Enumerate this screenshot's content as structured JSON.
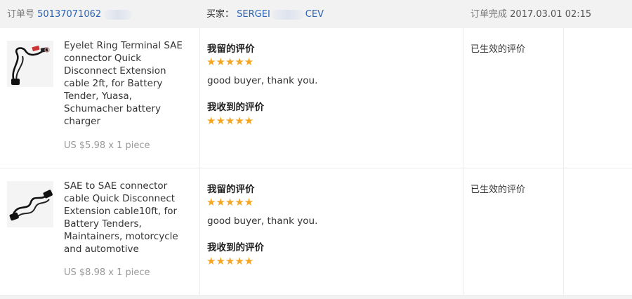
{
  "header": {
    "order_label": "订单号",
    "order_number": "50137071062",
    "buyer_label": "买家：",
    "buyer_name_start": "SERGEI",
    "buyer_name_end": "CEV",
    "status_label": "订单完成",
    "completed_time": "2017.03.01 02:15"
  },
  "orders": [
    {
      "product_title": "Eyelet Ring Terminal SAE connector Quick Disconnect Extension cable 2ft, for Battery Tender, Yuasa, Schumacher battery charger",
      "price": "US $5.98 x 1 piece",
      "given_label": "我留的评价",
      "given_stars": 5,
      "given_stars_text": "★★★★★",
      "given_comment": "good buyer, thank you.",
      "received_label": "我收到的评价",
      "received_stars": 5,
      "received_stars_text": "★★★★★",
      "status": "已生效的评价"
    },
    {
      "product_title": "SAE to SAE connector cable Quick Disconnect Extension cable10ft, for Battery Tenders, Maintainers, motorcycle and automotive",
      "price": "US $8.98 x 1 piece",
      "given_label": "我留的评价",
      "given_stars": 5,
      "given_stars_text": "★★★★★",
      "given_comment": "good buyer, thank you.",
      "received_label": "我收到的评价",
      "received_stars": 5,
      "received_stars_text": "★★★★★",
      "status": "已生效的评价"
    }
  ],
  "colors": {
    "link": "#2a63b6",
    "star": "#f5a623",
    "header_bg": "#f2f2f2"
  }
}
